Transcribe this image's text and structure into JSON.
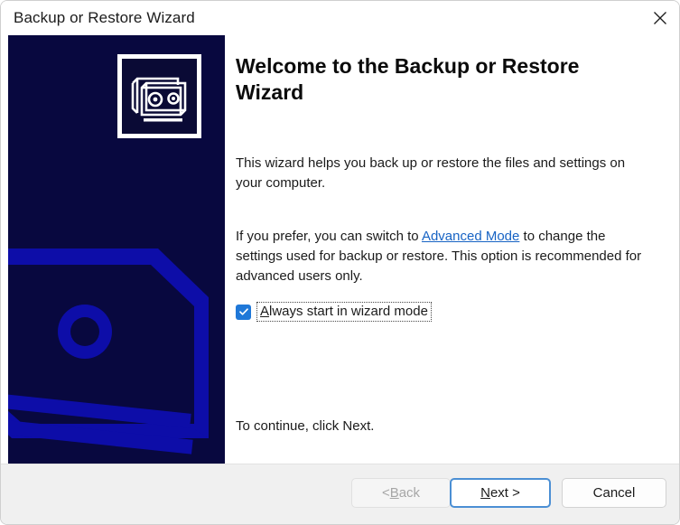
{
  "window": {
    "title": "Backup or Restore Wizard",
    "close_icon": "close-icon"
  },
  "sidebar": {
    "icon_name": "tape-cassette-icon",
    "watermark_name": "tape-cassette-watermark",
    "background_color": "#08083f",
    "watermark_color": "#0d0da8"
  },
  "main": {
    "heading": "Welcome to the Backup or Restore Wizard",
    "paragraph_1": "This wizard helps you back up or restore the files and settings on your computer.",
    "paragraph_2_before_link": "If you prefer, you can switch to ",
    "link_text": "Advanced Mode",
    "link_color": "#1763c4",
    "paragraph_2_after_link": " to change the settings used for backup or restore. This option is recommended for advanced users only.",
    "checkbox": {
      "label_accel": "A",
      "label_rest": "lways start in wizard mode",
      "checked": true,
      "accent_color": "#1f78d8"
    },
    "paragraph_3": "To continue, click Next."
  },
  "footer": {
    "back_button": {
      "prefix": "< ",
      "accel": "B",
      "rest": "ack",
      "disabled": true
    },
    "next_button": {
      "accel": "N",
      "rest": "ext >",
      "default": true,
      "border_color": "#4b8fd4"
    },
    "cancel_button": {
      "label": "Cancel"
    }
  }
}
